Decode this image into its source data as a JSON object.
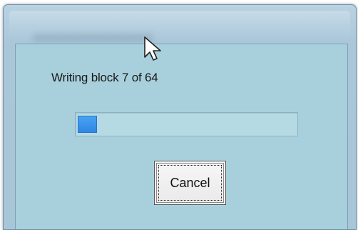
{
  "dialog": {
    "status_text": "Writing block 7 of 64",
    "progress": {
      "current_block": 7,
      "total_blocks": 64,
      "fill_fraction": 0.09
    },
    "cancel_label": "Cancel"
  },
  "icons": {
    "cursor": "mouse-pointer-icon"
  },
  "colors": {
    "dialog_background": "#a8d0dc",
    "progress_fill": "#3a94ee"
  }
}
